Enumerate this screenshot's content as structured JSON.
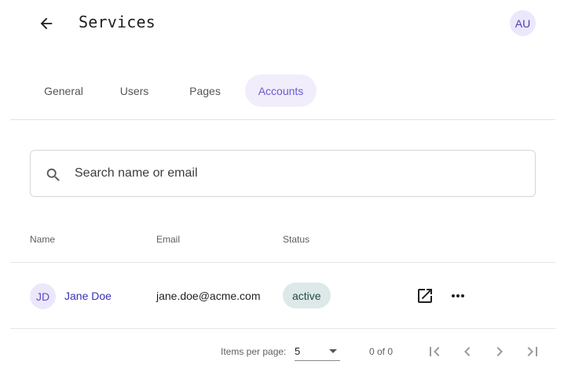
{
  "header": {
    "title": "Services",
    "user_initials": "AU"
  },
  "tabs": [
    {
      "label": "General",
      "active": false
    },
    {
      "label": "Users",
      "active": false
    },
    {
      "label": "Pages",
      "active": false
    },
    {
      "label": "Accounts",
      "active": true
    }
  ],
  "search": {
    "placeholder": "Search name or email",
    "value": ""
  },
  "table": {
    "columns": [
      "Name",
      "Email",
      "Status"
    ],
    "rows": [
      {
        "initials": "JD",
        "name": "Jane Doe",
        "email": "jane.doe@acme.com",
        "status": "active"
      }
    ]
  },
  "paginator": {
    "items_per_page_label": "Items per page:",
    "items_per_page": "5",
    "range_label": "0 of 0"
  },
  "colors": {
    "accent": "#6a5bd0",
    "tab_active_bg": "#f1edfb",
    "status_active_bg": "#dde9e8",
    "link": "#3a2fb5"
  },
  "icons": {
    "back": "arrow-left-icon",
    "search": "search-icon",
    "open": "open-in-new-icon",
    "more": "more-horizontal-icon",
    "first": "first-page-icon",
    "prev": "chevron-left-icon",
    "next": "chevron-right-icon",
    "last": "last-page-icon"
  }
}
